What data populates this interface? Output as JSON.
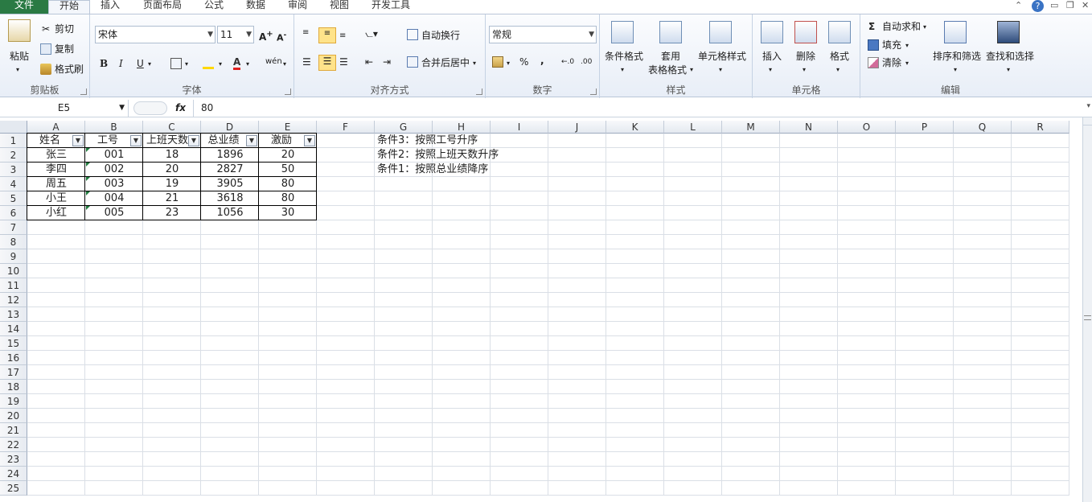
{
  "tabs": {
    "file": "文件",
    "home": "开始",
    "insert": "插入",
    "layout": "页面布局",
    "formulas": "公式",
    "data": "数据",
    "review": "审阅",
    "view": "视图",
    "dev": "开发工具"
  },
  "ribbon": {
    "clipboard": {
      "paste": "粘贴",
      "cut": "剪切",
      "copy": "复制",
      "format_painter": "格式刷",
      "label": "剪贴板"
    },
    "font": {
      "name": "宋体",
      "size": "11",
      "bold": "B",
      "italic": "I",
      "underline": "U",
      "label": "字体"
    },
    "alignment": {
      "wrap": "自动换行",
      "merge": "合并后居中",
      "label": "对齐方式"
    },
    "number": {
      "format": "常规",
      "percent": "%",
      "comma": ",",
      "label": "数字"
    },
    "styles": {
      "cond": "条件格式",
      "table_1": "套用",
      "table_2": "表格格式",
      "cell_styles": "单元格样式",
      "label": "样式"
    },
    "cells": {
      "insert": "插入",
      "delete": "删除",
      "format": "格式",
      "label": "单元格"
    },
    "editing": {
      "autosum": "自动求和",
      "fill": "填充",
      "clear": "清除",
      "sort": "排序和筛选",
      "find": "查找和选择",
      "label": "编辑"
    }
  },
  "formula_bar": {
    "name_box": "E5",
    "fx": "fx",
    "value": "80"
  },
  "columns": [
    "A",
    "B",
    "C",
    "D",
    "E",
    "F",
    "G",
    "H",
    "I",
    "J",
    "K",
    "L",
    "M",
    "N",
    "O",
    "P",
    "Q",
    "R"
  ],
  "rows": [
    "1",
    "2",
    "3",
    "4",
    "5",
    "6",
    "7",
    "8",
    "9",
    "10",
    "11",
    "12",
    "13",
    "14",
    "15",
    "16",
    "17",
    "18",
    "19",
    "20",
    "21",
    "22",
    "23",
    "24",
    "25"
  ],
  "table": {
    "headers": [
      "姓名",
      "工号",
      "上班天数",
      "总业绩",
      "激励"
    ],
    "data": [
      [
        "张三",
        "001",
        "18",
        "1896",
        "20"
      ],
      [
        "李四",
        "002",
        "20",
        "2827",
        "50"
      ],
      [
        "周五",
        "003",
        "19",
        "3905",
        "80"
      ],
      [
        "小王",
        "004",
        "21",
        "3618",
        "80"
      ],
      [
        "小红",
        "005",
        "23",
        "1056",
        "30"
      ]
    ]
  },
  "notes": [
    "条件3：按照工号升序",
    "条件2：按照上班天数升序",
    "条件1：按照总业绩降序"
  ]
}
